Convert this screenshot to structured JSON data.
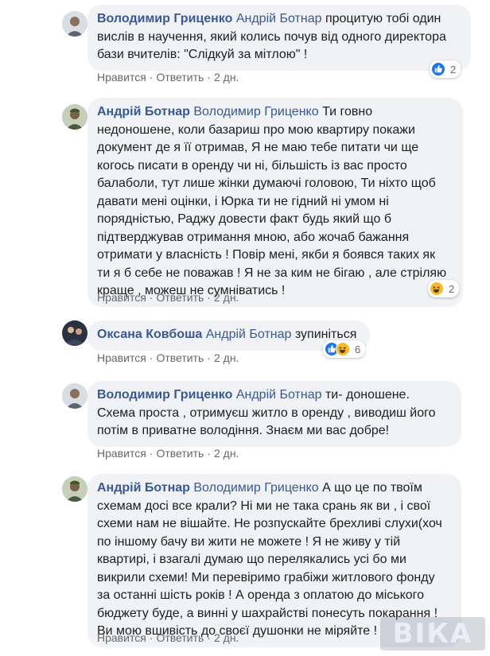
{
  "comments": [
    {
      "author": "Володимир Гриценко",
      "mention": "Андрій Ботнар",
      "lines": [
        "процитую тобі один",
        "вислів в научення, який колись почув від одного директора",
        "бази вчителів: \"Слідкуй за мітлою\" !"
      ],
      "like_label": "Нравится",
      "reply_label": "Ответить",
      "time": "2 дн.",
      "reactions": [
        "like"
      ],
      "reaction_count": "2"
    },
    {
      "author": "Андрій Ботнар",
      "mention": "Володимир Гриценко",
      "lines": [
        "Ти говно",
        "недоношене, коли базариш про мою квартиру покажи",
        "документ де я її отримав, Я не маю тебе питати чи ще",
        "когось писати в оренду чи ні, більшість із вас просто",
        "балаболи, тут лише жінки думаючі головою, Ти ніхто щоб",
        "давати мені оцінки, і Юрка ти не гідний ні умом ні",
        "порядністью, Раджу довести факт будь який що б",
        "підтверджував отримання мною, або жочаб бажання",
        "отримати у власність ! Повір мені, якби я боявся таких як",
        "ти я б себе не поважав ! Я не за ким не бігаю , але стріляю",
        "краще , можеш не сумніватись !"
      ],
      "like_label": "Нравится",
      "reply_label": "Ответить",
      "time": "2 дн.",
      "reactions": [
        "haha"
      ],
      "reaction_count": "2"
    },
    {
      "author": "Оксана Ковбоша",
      "mention": "Андрій Ботнар",
      "lines": [
        "зупиніться"
      ],
      "like_label": "Нравится",
      "reply_label": "Ответить",
      "time": "2 дн.",
      "reactions": [
        "like",
        "haha"
      ],
      "reaction_count": "6"
    },
    {
      "author": "Володимир Гриценко",
      "mention": "Андрій Ботнар",
      "lines": [
        "ти- доношене.",
        "Схема проста , отримуєш житло в оренду , виводиш його",
        "потім в приватне володіння. Знаєм ми вас добре!"
      ],
      "like_label": "Нравится",
      "reply_label": "Ответить",
      "time": "2 дн.",
      "reactions": [],
      "reaction_count": ""
    },
    {
      "author": "Андрій Ботнар",
      "mention": "Володимир Гриценко",
      "lines": [
        "А що це по твоїм",
        "схемам досі все крали? Ні ми не така срань як ви , і свої",
        "схеми нам не вішайте. Не розпускайте брехливі слухи(хоч",
        "по іншому бачу ви жити не можете ! Я не живу у тій",
        "квартирі, і взагалі думаю що перелякались усі бо ми",
        "викрили схеми! Ми перевіримо грабіжи житлового фонду",
        "за останні шість років ! А оренда з оплатою до міського",
        "бюджету буде, а винні у шахрайстві понесуть покарання !",
        "Ви мою вшивість до своєї душонки не міряйте !"
      ],
      "like_label": "Нравится",
      "reply_label": "Ответить",
      "time": "2 дн.",
      "reactions": [],
      "reaction_count": ""
    }
  ],
  "watermark": "ВІКА",
  "colors": {
    "name": "#385898",
    "bubble": "#f0f2f5",
    "meta": "#65676b",
    "like": "#1877f2",
    "haha": "#f7b928"
  }
}
